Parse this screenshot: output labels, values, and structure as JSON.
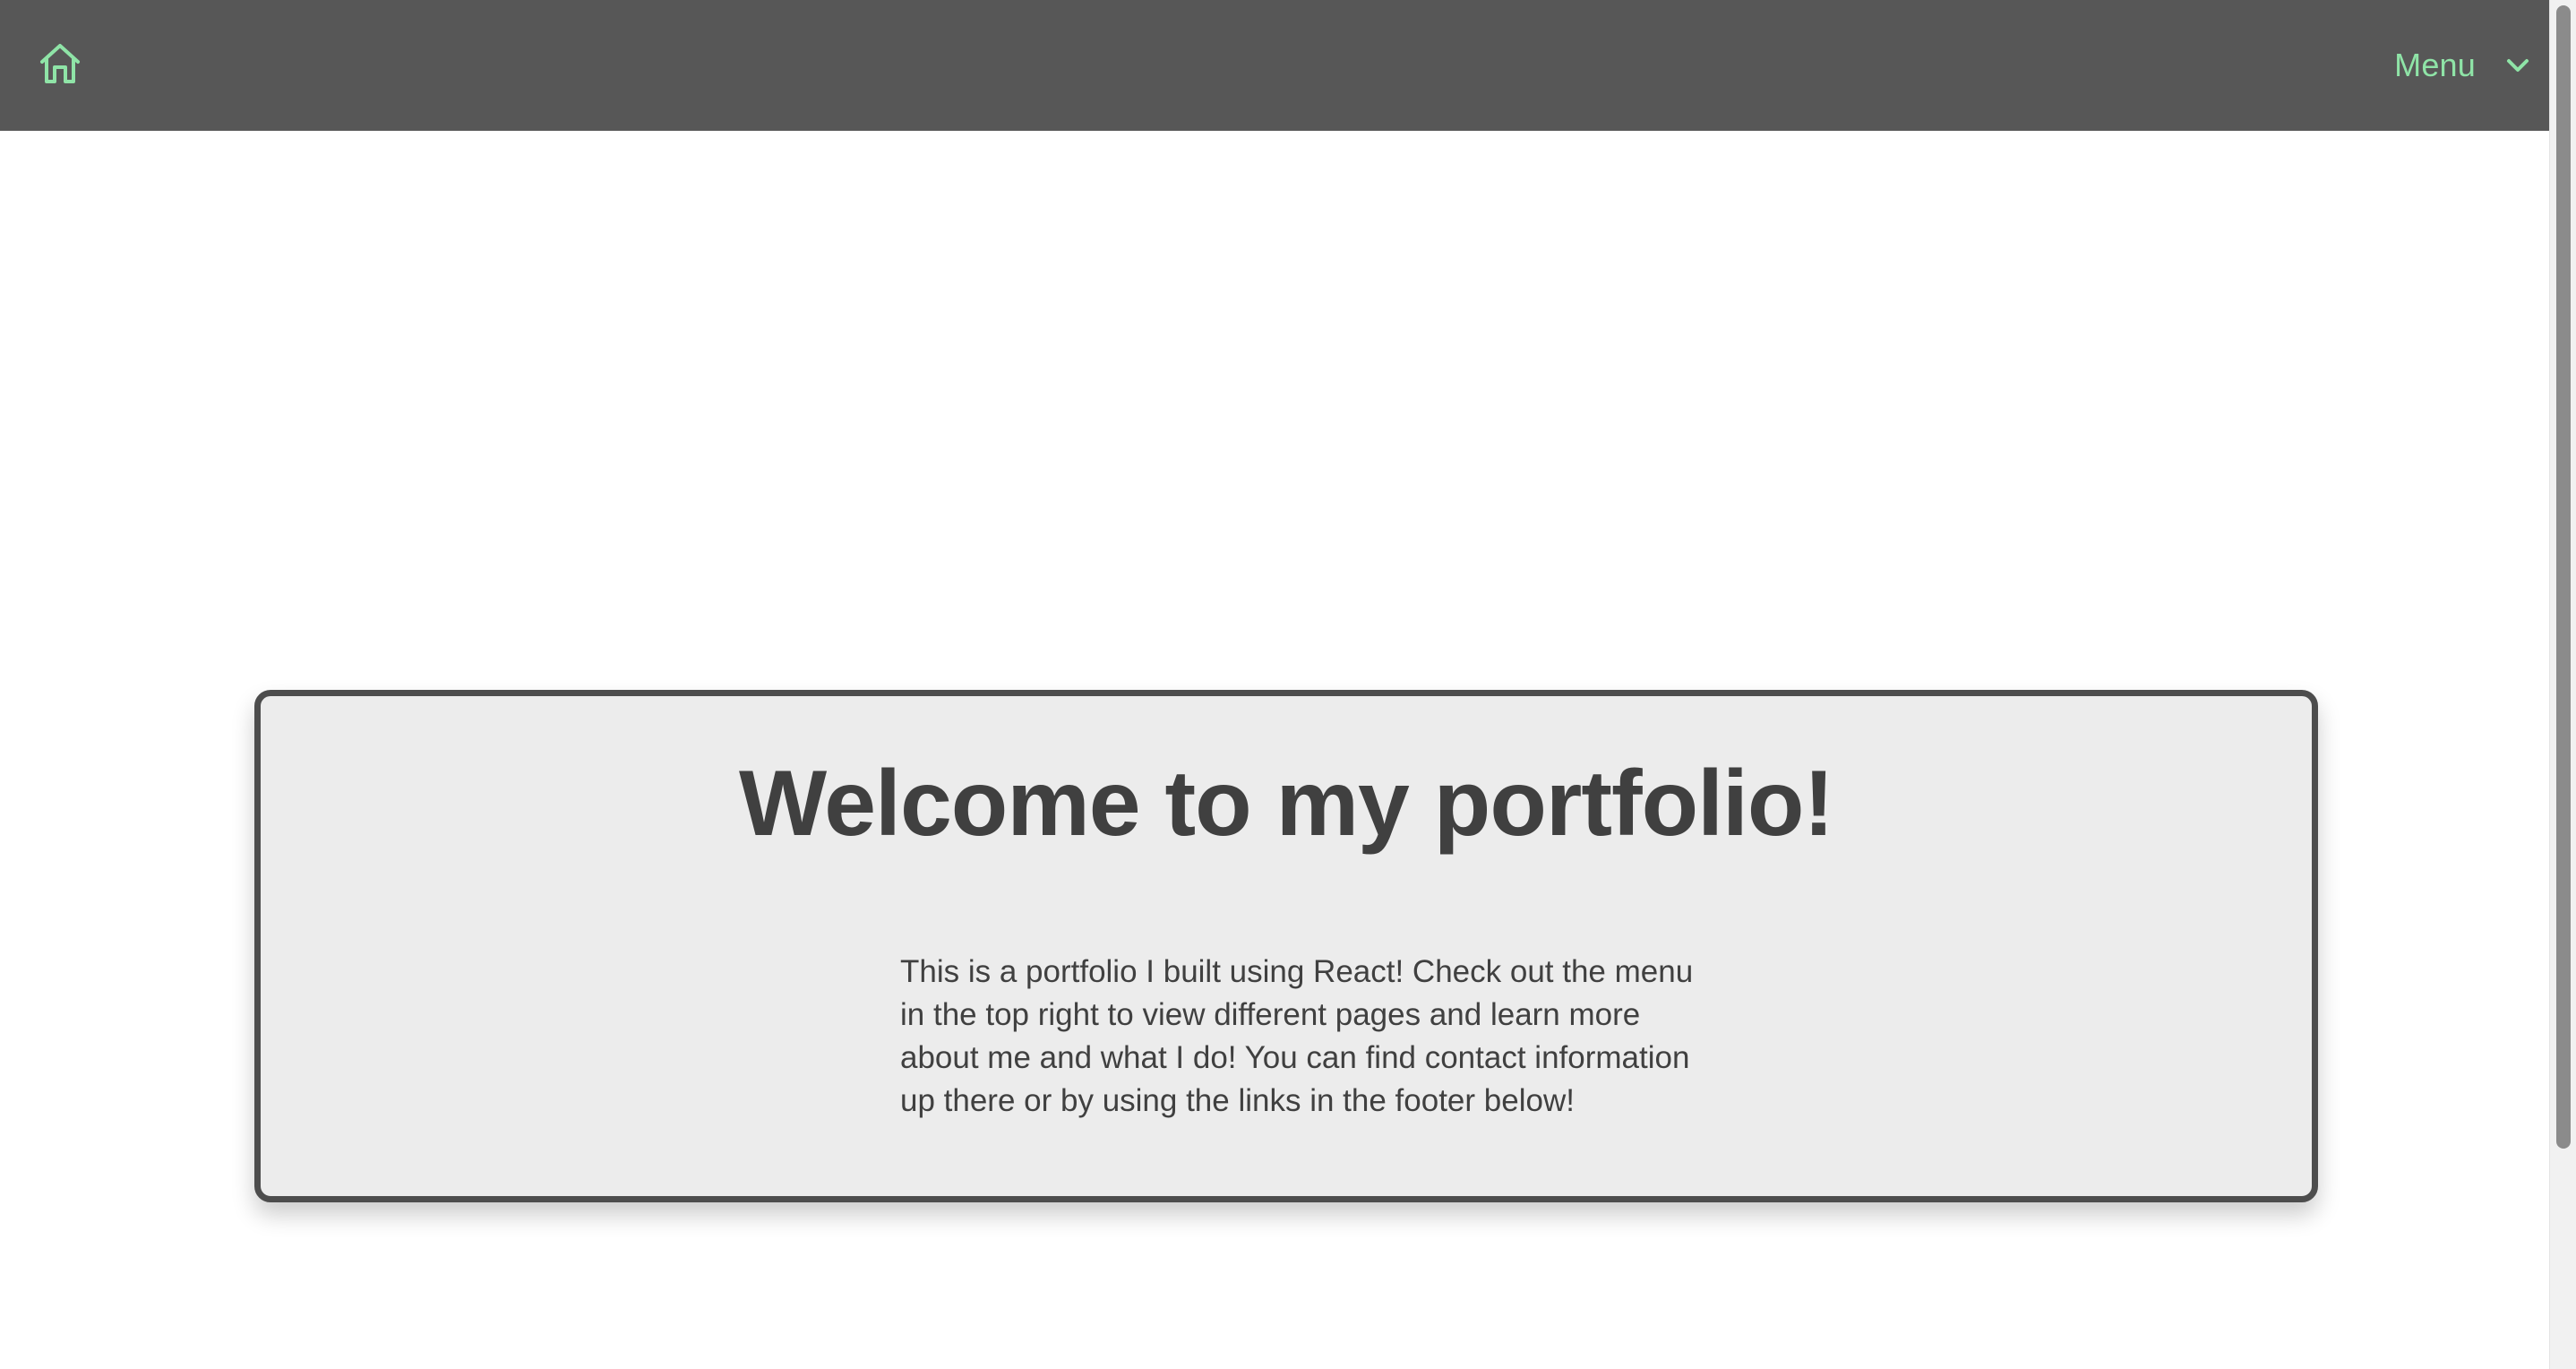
{
  "navbar": {
    "home_icon": "home-icon",
    "menu_label": "Menu",
    "menu_icon": "chevron-down-icon",
    "accent_color": "#8fe4a7",
    "background_color": "#575757"
  },
  "main": {
    "title": "Welcome to my portfolio!",
    "description": "This is a portfolio I built using React! Check out the menu in the top right to view different pages and learn more about me and what I do! You can find contact information up there or by using the links in the footer below!",
    "card_background_color": "#ececec",
    "card_border_color": "#4d4d4d",
    "text_color": "#404040"
  }
}
